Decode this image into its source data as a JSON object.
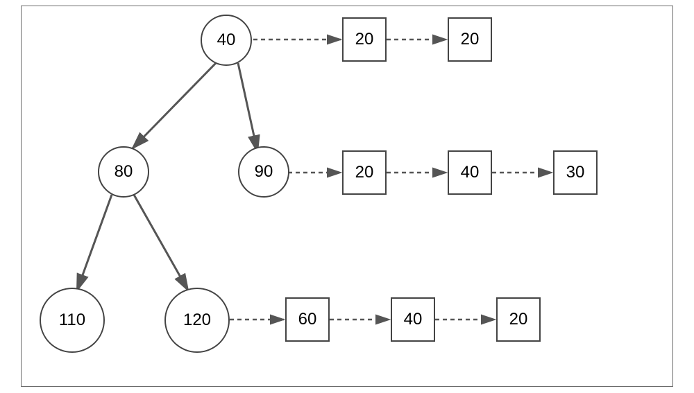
{
  "chart_data": {
    "type": "tree-diagram",
    "title": "",
    "nodes": {
      "n40": {
        "shape": "circle",
        "label": "40",
        "children": [
          "n80",
          "n90"
        ],
        "attached_boxes": [
          "20",
          "20"
        ]
      },
      "n80": {
        "shape": "circle",
        "label": "80",
        "children": [
          "n110",
          "n120"
        ],
        "attached_boxes": []
      },
      "n90": {
        "shape": "circle",
        "label": "90",
        "children": [],
        "attached_boxes": [
          "20",
          "40",
          "30"
        ]
      },
      "n110": {
        "shape": "circle",
        "label": "110",
        "children": [],
        "attached_boxes": []
      },
      "n120": {
        "shape": "circle",
        "label": "120",
        "children": [],
        "attached_boxes": [
          "60",
          "40",
          "20"
        ]
      }
    },
    "solid_edges": [
      {
        "from": "n40",
        "to": "n80"
      },
      {
        "from": "n40",
        "to": "n90"
      },
      {
        "from": "n80",
        "to": "n110"
      },
      {
        "from": "n80",
        "to": "n120"
      }
    ],
    "dashed_chains": [
      {
        "from": "n40",
        "boxes": [
          "b1a",
          "b1b"
        ]
      },
      {
        "from": "n90",
        "boxes": [
          "b2a",
          "b2b",
          "b2c"
        ]
      },
      {
        "from": "n120",
        "boxes": [
          "b3a",
          "b3b",
          "b3c"
        ]
      }
    ]
  },
  "labels": {
    "n40": "40",
    "n80": "80",
    "n90": "90",
    "n110": "110",
    "n120": "120",
    "b1a": "20",
    "b1b": "20",
    "b2a": "20",
    "b2b": "40",
    "b2c": "30",
    "b3a": "60",
    "b3b": "40",
    "b3c": "20"
  }
}
